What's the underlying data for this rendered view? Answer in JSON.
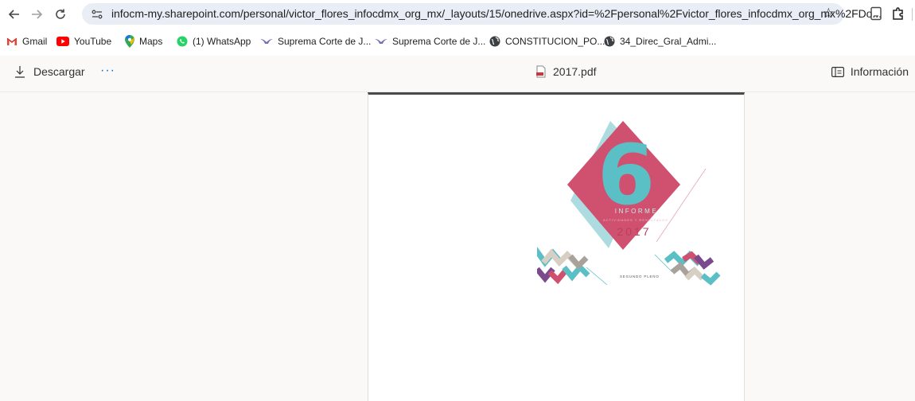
{
  "browser": {
    "url": "infocm-my.sharepoint.com/personal/victor_flores_infocdmx_org_mx/_layouts/15/onedrive.aspx?id=%2Fpersonal%2Fvictor_flores_infocdmx_org_mx%2FDo..."
  },
  "bookmarks": [
    {
      "label": "Gmail",
      "icon": "gmail-icon"
    },
    {
      "label": "YouTube",
      "icon": "youtube-icon"
    },
    {
      "label": "Maps",
      "icon": "maps-icon"
    },
    {
      "label": "(1) WhatsApp",
      "icon": "whatsapp-icon"
    },
    {
      "label": "Suprema Corte de J...",
      "icon": "scjn-icon"
    },
    {
      "label": "Suprema Corte de J...",
      "icon": "scjn-icon"
    },
    {
      "label": "CONSTITUCION_PO...",
      "icon": "globe-icon"
    },
    {
      "label": "34_Direc_Gral_Admi...",
      "icon": "globe-icon"
    }
  ],
  "viewer": {
    "download_label": "Descargar",
    "more_label": "···",
    "file_name": "2017.pdf",
    "info_label": "Información"
  },
  "cover": {
    "number": "6",
    "title": "INFORME",
    "subtitle": "ACTIVIDADES Y RESULTADOS",
    "year": "2017",
    "tagline": "SEGUNDO PLENO"
  },
  "colors": {
    "accent_blue": "#0f6cbd",
    "diamond_pink": "#d0516f",
    "diamond_teal": "#5bbfc6",
    "omnibox_bg": "#e9eef6"
  }
}
